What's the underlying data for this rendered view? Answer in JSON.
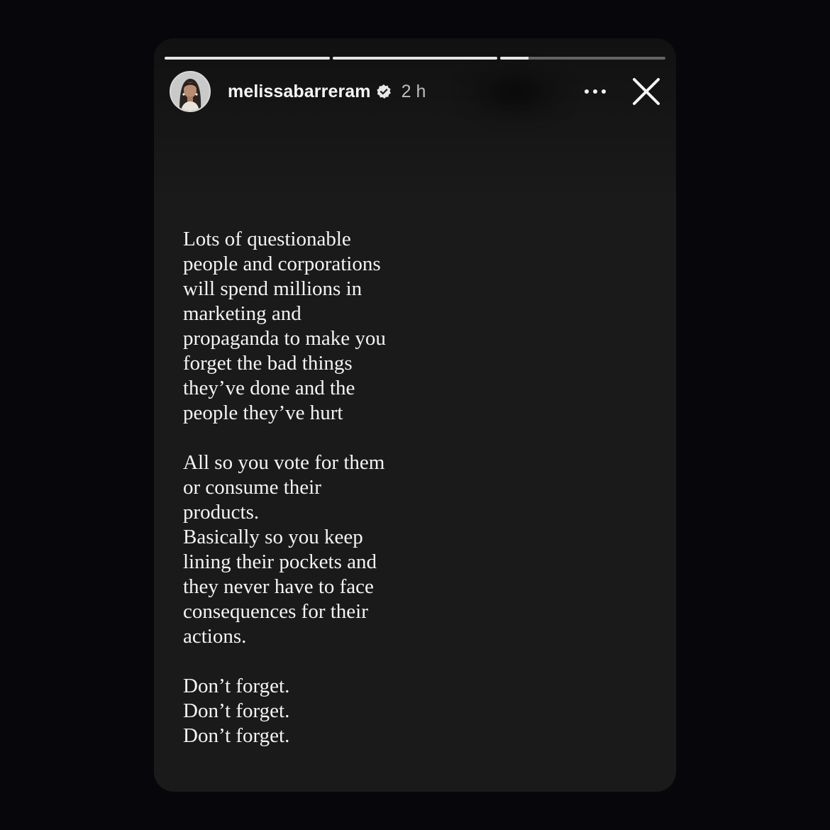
{
  "story": {
    "progress": [
      1.0,
      1.0,
      0.17
    ],
    "user": {
      "username": "melissabarreram",
      "verified": true,
      "time": "2 h",
      "avatar_icon": "profile-photo"
    },
    "controls": {
      "more_icon": "more-horizontal-icon",
      "close_icon": "close-icon"
    },
    "text": {
      "paragraphs": [
        [
          "Lots of questionable",
          "people and corporations",
          "will spend millions in",
          "marketing and",
          "propaganda to make you",
          "forget the bad things",
          "they’ve done and the",
          "people they’ve hurt"
        ],
        [
          "All so you vote for them",
          "or consume their",
          "products.",
          "Basically so you keep",
          "lining their pockets and",
          "they never have to face",
          "consequences for their",
          "actions."
        ],
        [
          "Don’t forget.",
          "Don’t forget.",
          "Don’t forget."
        ]
      ]
    }
  },
  "colors": {
    "page_background": "#07070b",
    "card_background": "#1a1a1a",
    "text": "#f4f4f4",
    "progress_track": "rgba(255,255,255,0.35)",
    "progress_fill": "#e6e6e6",
    "verified_badge": "#e8e8e8"
  }
}
